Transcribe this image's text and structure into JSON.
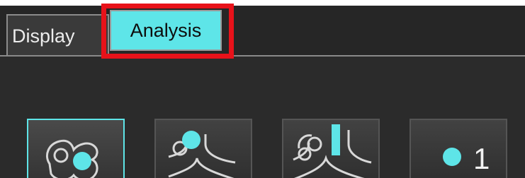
{
  "tabs": {
    "display_label": "Display",
    "analysis_label": "Analysis",
    "active": "Analysis"
  },
  "colors": {
    "accent": "#5ee5e8",
    "highlight": "#e8121a",
    "panel_bg": "#2b2b2b"
  },
  "tools": [
    {
      "icon": "vessel-cross-section-icon",
      "active": true
    },
    {
      "icon": "vessel-bifurcation-roi-icon",
      "active": false
    },
    {
      "icon": "vessel-bifurcation-column-icon",
      "active": false
    },
    {
      "icon": "roi-count-icon",
      "active": false,
      "label": "1"
    }
  ]
}
